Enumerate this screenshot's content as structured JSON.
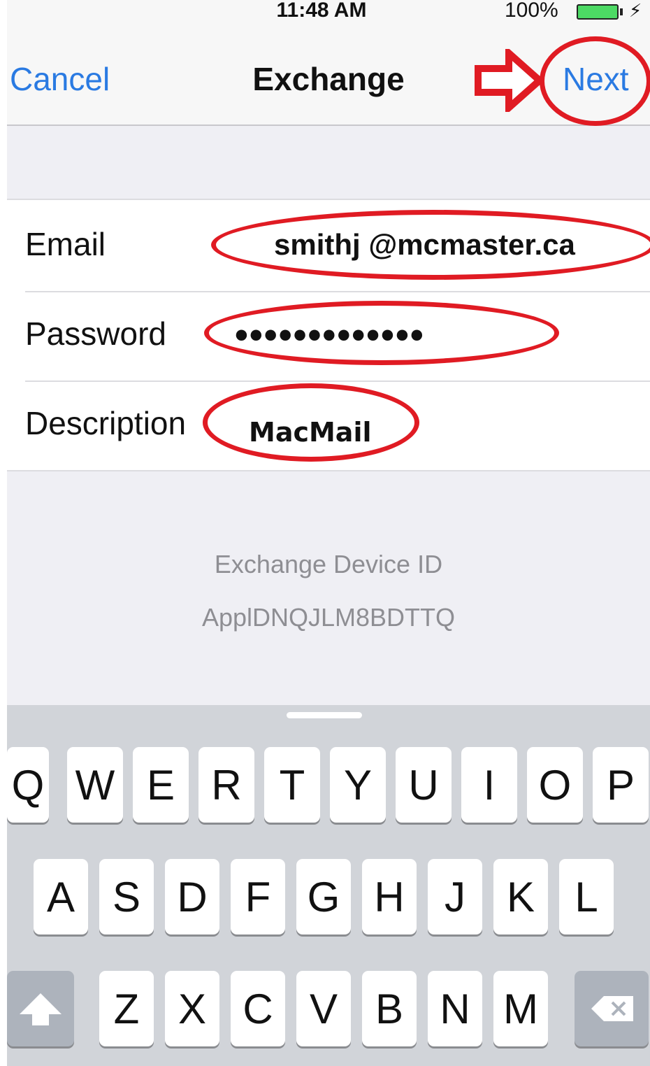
{
  "status": {
    "time": "11:48 AM",
    "battery": "100%"
  },
  "nav": {
    "cancel": "Cancel",
    "title": "Exchange",
    "next": "Next"
  },
  "form": {
    "email": {
      "label": "Email",
      "value": "smithj @mcmaster.ca"
    },
    "password": {
      "label": "Password",
      "value": "•••••••••••••"
    },
    "description": {
      "label": "Description",
      "value": "MacMail"
    }
  },
  "device": {
    "label": "Exchange Device ID",
    "id": "ApplDNQJLM8BDTTQ"
  },
  "keyboard": {
    "row1": [
      "Q",
      "W",
      "E",
      "R",
      "T",
      "Y",
      "U",
      "I",
      "O",
      "P"
    ],
    "row2": [
      "A",
      "S",
      "D",
      "F",
      "G",
      "H",
      "J",
      "K",
      "L"
    ],
    "row3": [
      "Z",
      "X",
      "C",
      "V",
      "B",
      "N",
      "M"
    ],
    "shift_icon": "shift-arrow-icon",
    "delete_icon": "backspace-icon"
  },
  "colors": {
    "link_blue": "#2a7ae2",
    "annotation_red": "#e01b23",
    "battery_green": "#4cd964"
  }
}
